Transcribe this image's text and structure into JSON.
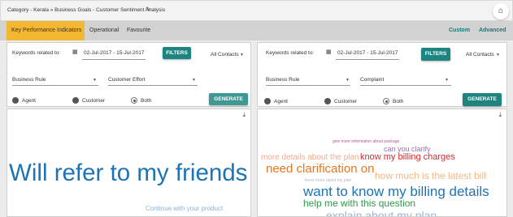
{
  "header": {
    "breadcrumb": "Category - Kerala » Business Goals - Customer Sentiment Analysis",
    "edit_icon": "pencil-icon",
    "home_icon": "home-icon"
  },
  "tabs": {
    "items": [
      "Key Performance Indicators",
      "Operational",
      "Favourite"
    ],
    "active_index": 0,
    "right_links": [
      "Custom",
      "Advanced"
    ]
  },
  "panels": [
    {
      "keywords_label": "Keywords related to:",
      "date_range": "02-Jul-2017 - 15-Jul-2017",
      "filters_label": "FILTERS",
      "contacts_select": "All Contacts",
      "select1": "Business Rule",
      "select2": "Customer Effort",
      "radios": [
        "Agent",
        "Customer",
        "Both"
      ],
      "selected_radio": "Both",
      "generate_label": "GENERATE"
    },
    {
      "keywords_label": "Keywords related to:",
      "date_range": "02-Jul-2017 - 15-Jul-2017",
      "filters_label": "FILTERS",
      "contacts_select": "All Contacts",
      "select1": "Business Rule",
      "select2": "Complaint",
      "radios": [
        "Agent",
        "Customer",
        "Both"
      ],
      "selected_radio": "Both",
      "generate_label": "GENERATE"
    }
  ],
  "cloud_left": {
    "words": [
      {
        "text": "Will refer to my friends",
        "color": "#1e73b4"
      },
      {
        "text": "Continue with your product",
        "color": "#8fb1d8"
      }
    ]
  },
  "cloud_right": {
    "words": [
      {
        "text": "give more information about package",
        "color": "#b55a8a"
      },
      {
        "text": "can you clarify",
        "color": "#9a6fb8"
      },
      {
        "text": "more details about the plan",
        "color": "#f4a98c"
      },
      {
        "text": "know my billing charges",
        "color": "#d6282d"
      },
      {
        "text": "need clarification on",
        "color": "#e8761c"
      },
      {
        "text": "know more about my plan",
        "color": "#b8b0c8"
      },
      {
        "text": "how much is the latest bill",
        "color": "#f7b783"
      },
      {
        "text": "want to know my billing details",
        "color": "#1e73b4"
      },
      {
        "text": "help me with this question",
        "color": "#2e9a4a"
      },
      {
        "text": "explain about my plan",
        "color": "#9db4d6"
      }
    ]
  },
  "colors": {
    "accent": "#1e8480",
    "active_tab": "#f4b731",
    "link": "#147a78"
  }
}
